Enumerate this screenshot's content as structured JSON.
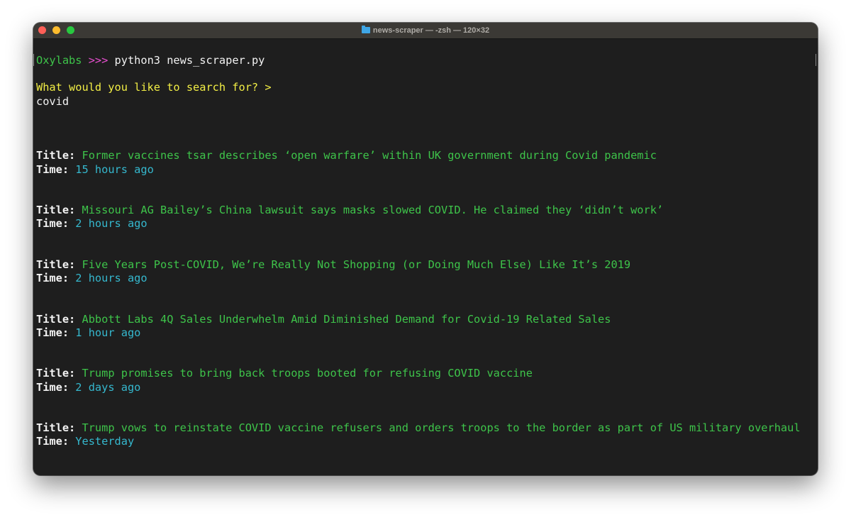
{
  "window": {
    "title": "news-scraper — -zsh — 120×32"
  },
  "prompt": {
    "host": "Oxylabs",
    "arrows": ">>>",
    "command": "python3 news_scraper.py"
  },
  "query": {
    "question": "What would you like to search for? >",
    "answer": "covid"
  },
  "labels": {
    "title": "Title:",
    "time": "Time:"
  },
  "results": [
    {
      "title": "Former vaccines tsar describes ‘open warfare’ within UK government during Covid pandemic",
      "time": "15 hours ago"
    },
    {
      "title": "Missouri AG Bailey’s China lawsuit says masks slowed COVID. He claimed they ‘didn’t work’",
      "time": "2 hours ago"
    },
    {
      "title": "Five Years Post-COVID, We’re Really Not Shopping (or Doing Much Else) Like It’s 2019",
      "time": "2 hours ago"
    },
    {
      "title": "Abbott Labs 4Q Sales Underwhelm Amid Diminished Demand for Covid-19 Related Sales",
      "time": "1 hour ago"
    },
    {
      "title": "Trump promises to bring back troops booted for refusing COVID vaccine",
      "time": "2 days ago"
    },
    {
      "title": "Trump vows to reinstate COVID vaccine refusers and orders troops to the border as part of US military overhaul",
      "time": "Yesterday"
    }
  ],
  "colors": {
    "background": "#1e1e1e",
    "title_text": "#3ec44a",
    "time_text": "#35b8ce",
    "prompt_arrows": "#e84fd0",
    "question_text": "#f2ee45"
  }
}
